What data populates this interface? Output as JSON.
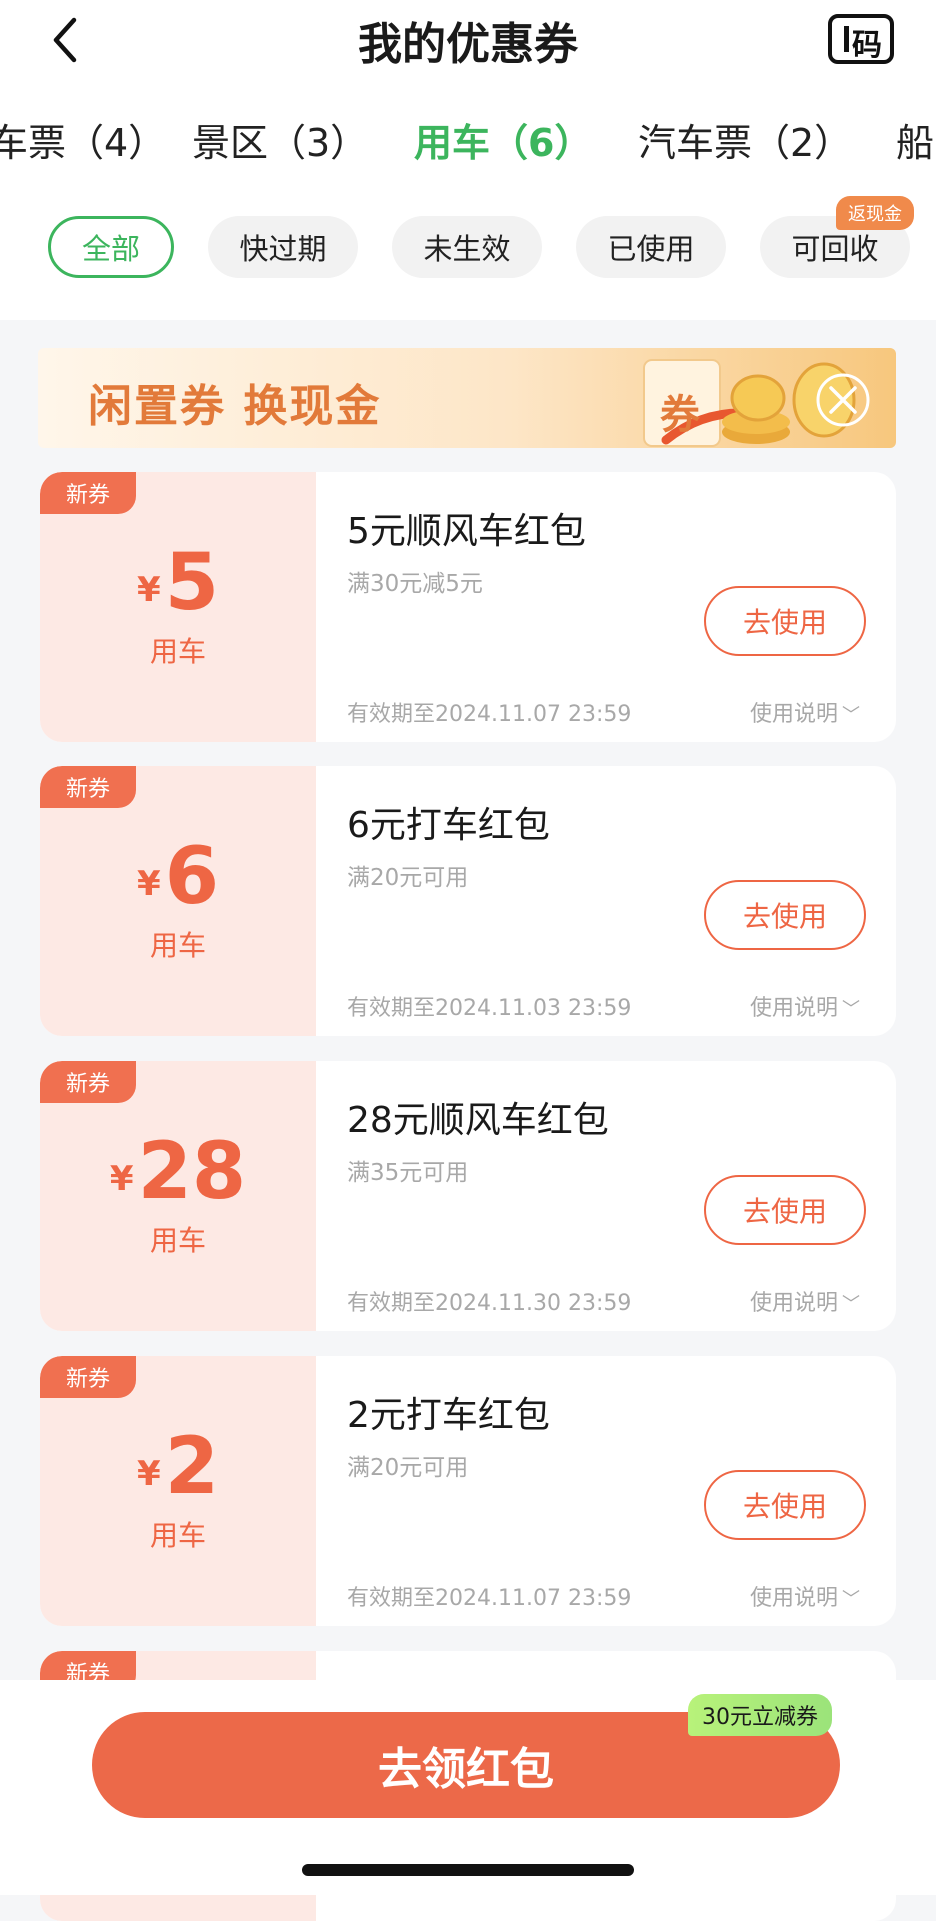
{
  "header": {
    "title": "我的优惠券",
    "code_label": "码"
  },
  "tabs": [
    {
      "label": "车票（4）"
    },
    {
      "label": "景区（3）"
    },
    {
      "label": "用车（6）"
    },
    {
      "label": "汽车票（2）"
    },
    {
      "label": "船"
    }
  ],
  "filters": [
    {
      "label": "全部"
    },
    {
      "label": "快过期"
    },
    {
      "label": "未生效"
    },
    {
      "label": "已使用"
    },
    {
      "label": "可回收",
      "badge": "返现金"
    }
  ],
  "banner": {
    "text": "闲置券 换现金",
    "art_label": "券"
  },
  "coupons": [
    {
      "tag": "新券",
      "currency": "¥",
      "amount": "5",
      "category": "用车",
      "title": "5元顺风车红包",
      "condition": "满30元减5元",
      "button": "去使用",
      "validity": "有效期至2024.11.07 23:59",
      "info": "使用说明"
    },
    {
      "tag": "新券",
      "currency": "¥",
      "amount": "6",
      "category": "用车",
      "title": "6元打车红包",
      "condition": "满20元可用",
      "button": "去使用",
      "validity": "有效期至2024.11.03 23:59",
      "info": "使用说明"
    },
    {
      "tag": "新券",
      "currency": "¥",
      "amount": "28",
      "category": "用车",
      "title": "28元顺风车红包",
      "condition": "满35元可用",
      "button": "去使用",
      "validity": "有效期至2024.11.30 23:59",
      "info": "使用说明"
    },
    {
      "tag": "新券",
      "currency": "¥",
      "amount": "2",
      "category": "用车",
      "title": "2元打车红包",
      "condition": "满20元可用",
      "button": "去使用",
      "validity": "有效期至2024.11.07 23:59",
      "info": "使用说明"
    },
    {
      "tag": "新券"
    }
  ],
  "cta": {
    "label": "去领红包",
    "badge": "30元立减券"
  },
  "colors": {
    "accent_green": "#3cb55d",
    "coupon_red": "#ee6644",
    "cta": "#ec6949"
  }
}
